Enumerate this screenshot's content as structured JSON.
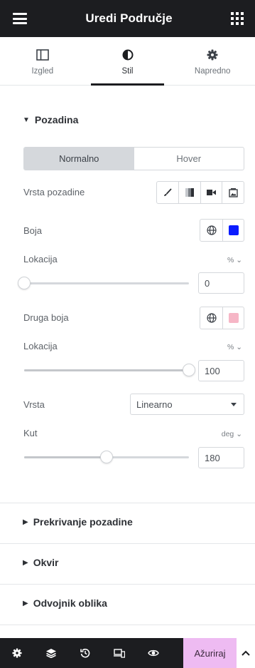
{
  "header": {
    "title": "Uredi Područje",
    "menu_icon": "hamburger-icon",
    "apps_icon": "grid-icon"
  },
  "tabs": [
    {
      "label": "Izgled",
      "icon": "layout-icon",
      "active": false
    },
    {
      "label": "Stil",
      "icon": "half-circle-icon",
      "active": true
    },
    {
      "label": "Napredno",
      "icon": "gear-icon",
      "active": false
    }
  ],
  "background_section": {
    "title": "Pozadina",
    "state_toggle": {
      "normal": "Normalno",
      "hover": "Hover",
      "selected": "Normalno"
    },
    "bg_type_label": "Vrsta pozadine",
    "bg_type_options": [
      "brush-icon",
      "gradient-icon",
      "video-icon",
      "slideshow-icon"
    ],
    "color_label": "Boja",
    "color_value": "#0b1cff",
    "location1_label": "Lokacija",
    "location1_unit": "%",
    "location1_value": "0",
    "location1_percent": 0,
    "second_color_label": "Druga boja",
    "second_color_value": "#f6b6c6",
    "location2_label": "Lokacija",
    "location2_unit": "%",
    "location2_value": "100",
    "location2_percent": 100,
    "type_label": "Vrsta",
    "type_value": "Linearno",
    "angle_label": "Kut",
    "angle_unit": "deg",
    "angle_value": "180",
    "angle_percent": 50
  },
  "collapsed_sections": [
    "Prekrivanje pozadine",
    "Okvir",
    "Odvojnik oblika"
  ],
  "footer": {
    "icons": [
      "settings-icon",
      "layers-icon",
      "history-icon",
      "responsive-icon",
      "preview-icon"
    ],
    "update_label": "Ažuriraj"
  }
}
